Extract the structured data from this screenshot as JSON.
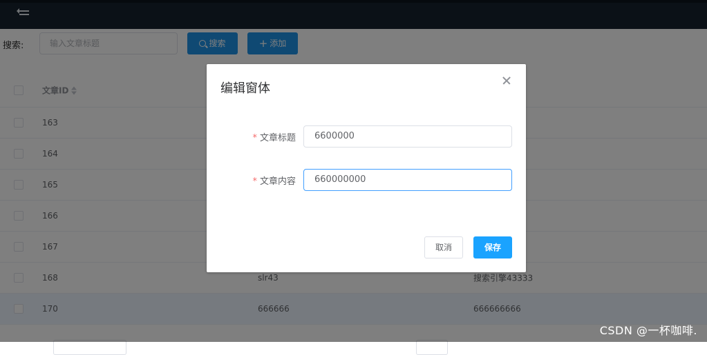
{
  "toolbar": {
    "search_label": "搜索:",
    "search_placeholder": "输入文章标题",
    "search_button": "搜索",
    "add_button": "添加"
  },
  "table": {
    "header": {
      "id": "文章ID"
    },
    "rows": [
      {
        "id": "163",
        "title": "",
        "content": ""
      },
      {
        "id": "164",
        "title": "",
        "content": ""
      },
      {
        "id": "165",
        "title": "",
        "content": ""
      },
      {
        "id": "166",
        "title": "",
        "content": ""
      },
      {
        "id": "167",
        "title": "",
        "content": ""
      },
      {
        "id": "168",
        "title": "slr43",
        "content": "搜索引擎43333"
      },
      {
        "id": "170",
        "title": "666666",
        "content": "666666666"
      }
    ]
  },
  "dialog": {
    "title": "编辑窗体",
    "fields": [
      {
        "label": "文章标题",
        "value": "6600000"
      },
      {
        "label": "文章内容",
        "value": "660000000"
      }
    ],
    "cancel": "取消",
    "save": "保存"
  },
  "watermark": "CSDN @一杯咖啡."
}
